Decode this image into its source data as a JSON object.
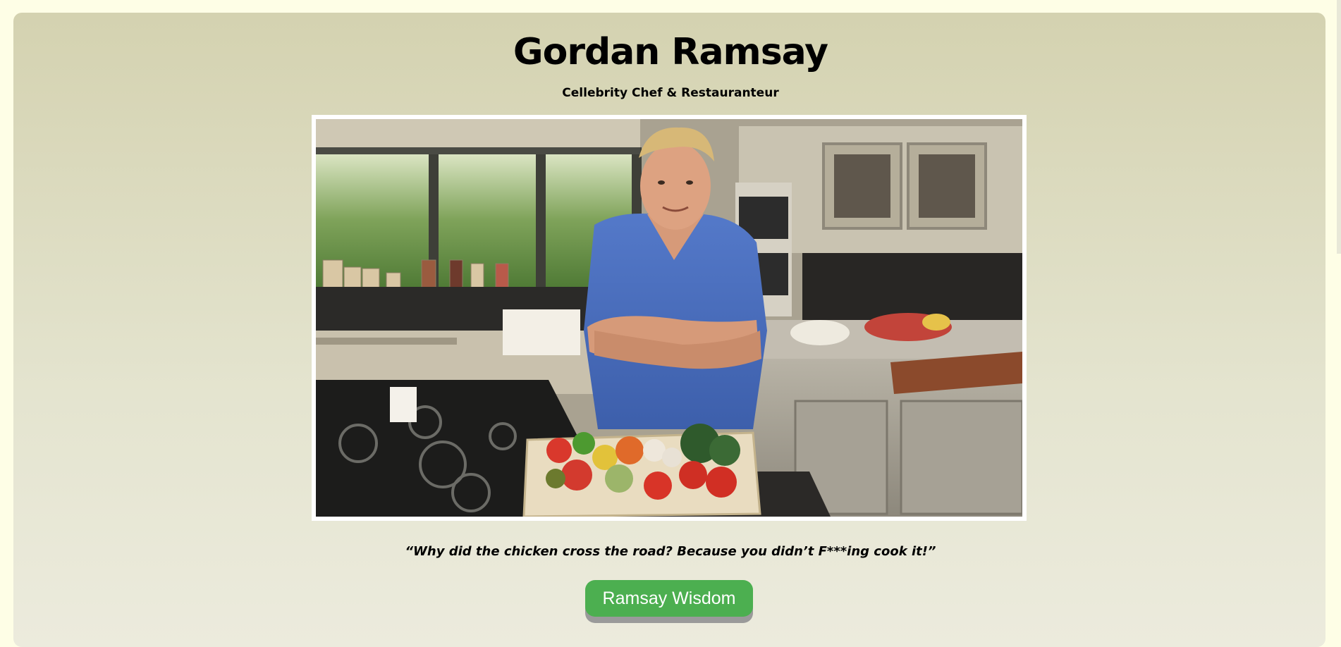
{
  "header": {
    "title": "Gordan Ramsay",
    "subtitle": "Cellebrity Chef & Restauranteur"
  },
  "photo": {
    "alt": "Gordon Ramsay in a kitchen with a crate of vegetables"
  },
  "quote": {
    "text": "“Why did the chicken cross the road? Because you didn’t F***ing cook it!”"
  },
  "actions": {
    "wisdom_button_label": "Ramsay Wisdom"
  },
  "colors": {
    "page_background": "#fefee6",
    "card_gradient_top": "#d4d2b0",
    "card_gradient_bottom": "#ecebdd",
    "button_green": "#4caf50",
    "button_shadow": "#9a9a9a",
    "shirt_blue": "#4a6fc0"
  }
}
